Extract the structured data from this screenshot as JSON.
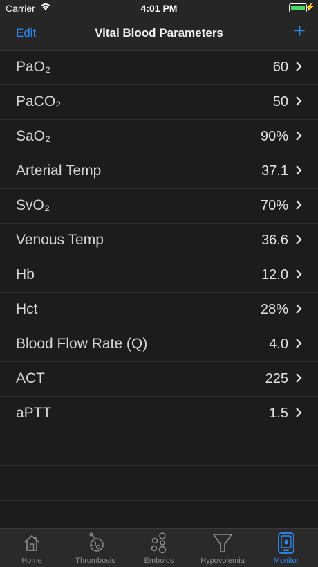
{
  "status_bar": {
    "carrier": "Carrier",
    "time": "4:01 PM"
  },
  "nav": {
    "edit_label": "Edit",
    "title": "Vital Blood Parameters",
    "add_label": "+"
  },
  "rows": [
    {
      "label": "PaO₂",
      "value": "60"
    },
    {
      "label": "PaCO₂",
      "value": "50"
    },
    {
      "label": "SaO₂",
      "value": "90%"
    },
    {
      "label": "Arterial Temp",
      "value": "37.1"
    },
    {
      "label": "SvO₂",
      "value": "70%"
    },
    {
      "label": "Venous Temp",
      "value": "36.6"
    },
    {
      "label": "Hb",
      "value": "12.0"
    },
    {
      "label": "Hct",
      "value": "28%"
    },
    {
      "label": "Blood Flow Rate (Q)",
      "value": "4.0"
    },
    {
      "label": "ACT",
      "value": "225"
    },
    {
      "label": "aPTT",
      "value": "1.5"
    }
  ],
  "tabs": [
    {
      "label": "Home",
      "icon": "home-icon"
    },
    {
      "label": "Thrombosis",
      "icon": "thrombosis-icon"
    },
    {
      "label": "Embolus",
      "icon": "embolus-icon"
    },
    {
      "label": "Hypovolemia",
      "icon": "funnel-icon"
    },
    {
      "label": "Monitor",
      "icon": "monitor-icon",
      "active": true
    }
  ],
  "colors": {
    "accent": "#2f8cf6",
    "background": "#1c1c1c",
    "battery": "#4cd964"
  }
}
